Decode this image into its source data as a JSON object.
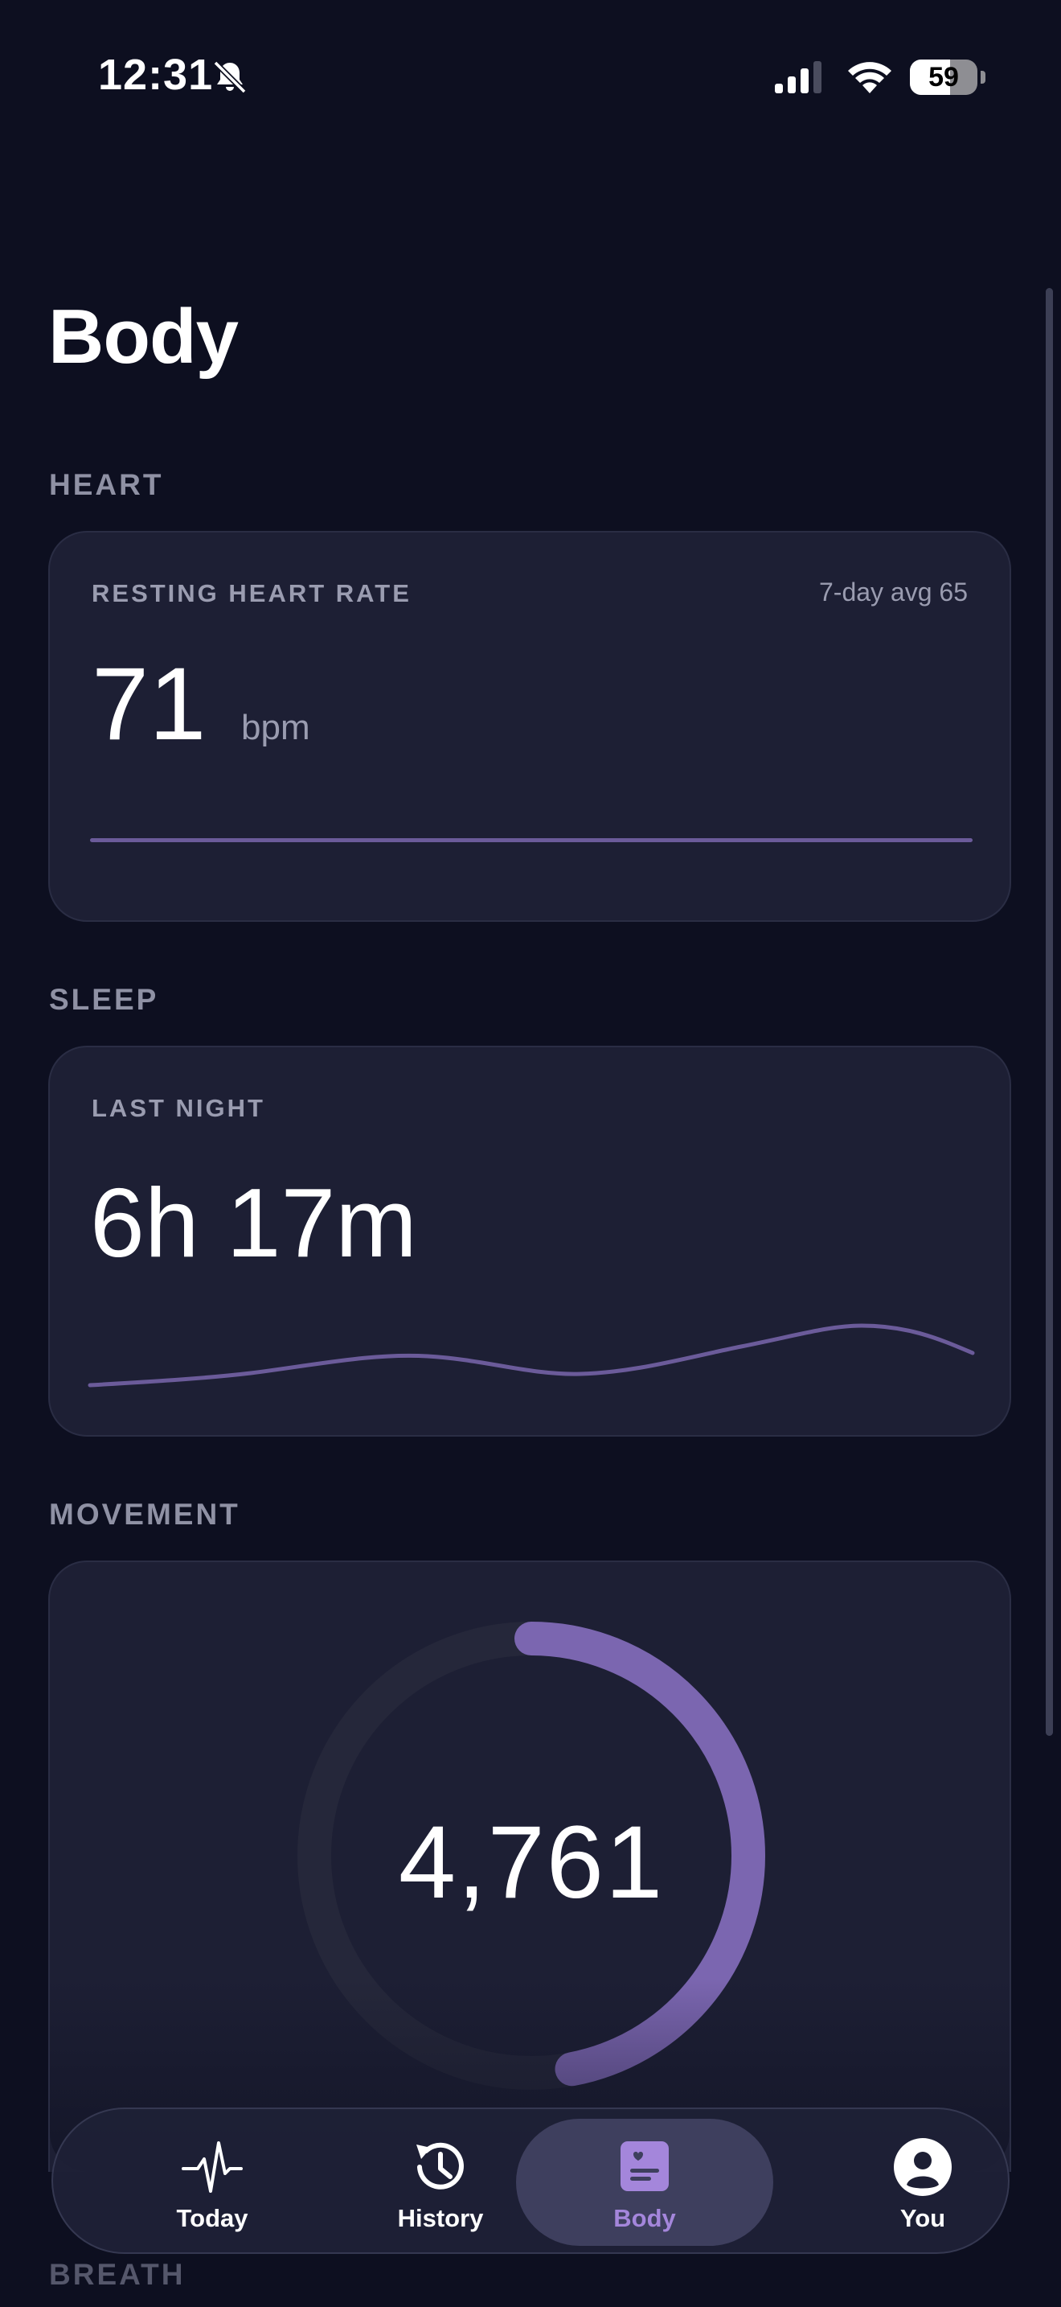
{
  "status_bar": {
    "time": "12:31",
    "battery_level": "59",
    "battery_fraction": 0.59,
    "icons": [
      "bell-slash-icon",
      "cellular-signal-icon",
      "wifi-icon",
      "battery-icon"
    ]
  },
  "page": {
    "title": "Body"
  },
  "sections": {
    "heart": {
      "label": "HEART",
      "card_label": "RESTING HEART RATE",
      "avg": "7-day avg 65",
      "value": "71",
      "unit": "bpm"
    },
    "sleep": {
      "label": "SLEEP",
      "card_label": "LAST NIGHT",
      "value": "6h 17m"
    },
    "movement": {
      "label": "MOVEMENT",
      "steps": "4,761",
      "ring_progress": 0.47
    },
    "breath": {
      "label": "BREATH"
    }
  },
  "tab_bar": {
    "tabs": [
      {
        "label": "Today",
        "icon": "pulse-icon",
        "active": false
      },
      {
        "label": "History",
        "icon": "history-clock-icon",
        "active": false
      },
      {
        "label": "Body",
        "icon": "body-report-icon",
        "active": true
      },
      {
        "label": "You",
        "icon": "person-icon",
        "active": false
      }
    ]
  },
  "colors": {
    "background": "#0d0f20",
    "card": "#1d1f34",
    "accent": "#7b66b0",
    "active_tab_label": "#a486db",
    "muted_text": "#9a9cb0"
  }
}
